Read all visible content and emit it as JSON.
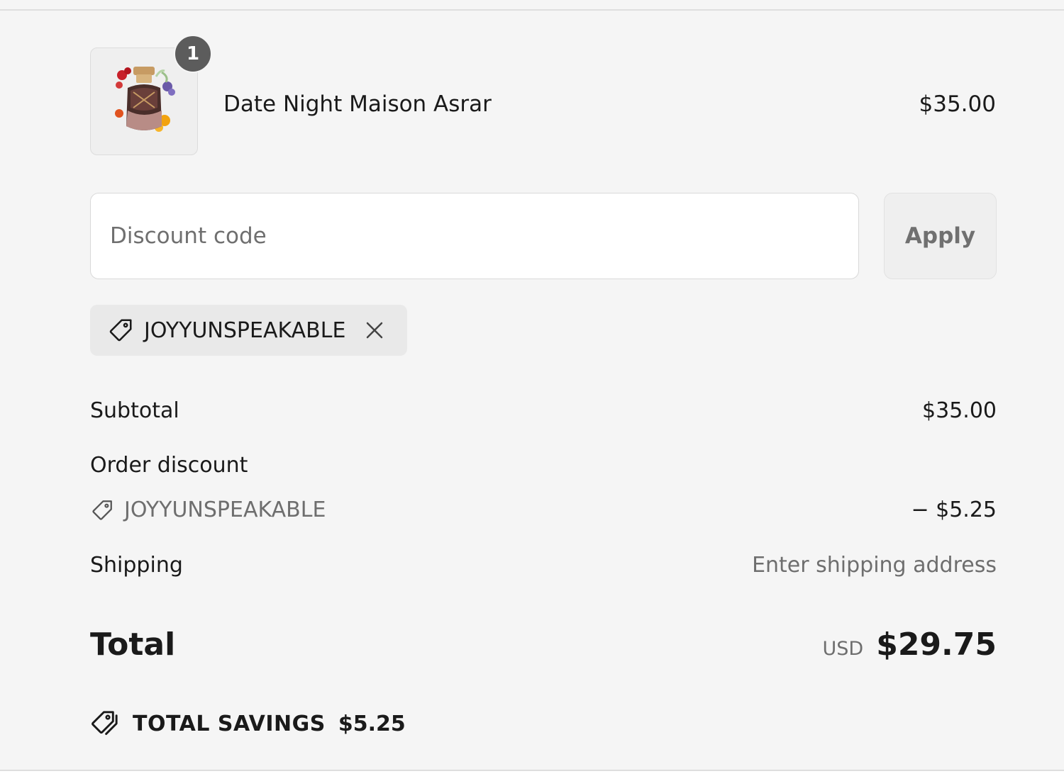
{
  "cart": {
    "item": {
      "name": "Date Night Maison Asrar",
      "price": "$35.00",
      "quantity": "1"
    }
  },
  "discount": {
    "placeholder": "Discount code",
    "apply_label": "Apply",
    "applied_code": "JOYYUNSPEAKABLE"
  },
  "summary": {
    "subtotal_label": "Subtotal",
    "subtotal_value": "$35.00",
    "order_discount_label": "Order discount",
    "order_discount_code": "JOYYUNSPEAKABLE",
    "order_discount_value": "− $5.25",
    "shipping_label": "Shipping",
    "shipping_value": "Enter shipping address",
    "total_label": "Total",
    "total_currency": "USD",
    "total_value": "$29.75",
    "savings_label": "TOTAL SAVINGS",
    "savings_value": "$5.25"
  },
  "icons": {
    "tag": "tag-icon",
    "close": "close-icon",
    "savings": "savings-tag-icon",
    "product": "perfume-bottle-image"
  }
}
